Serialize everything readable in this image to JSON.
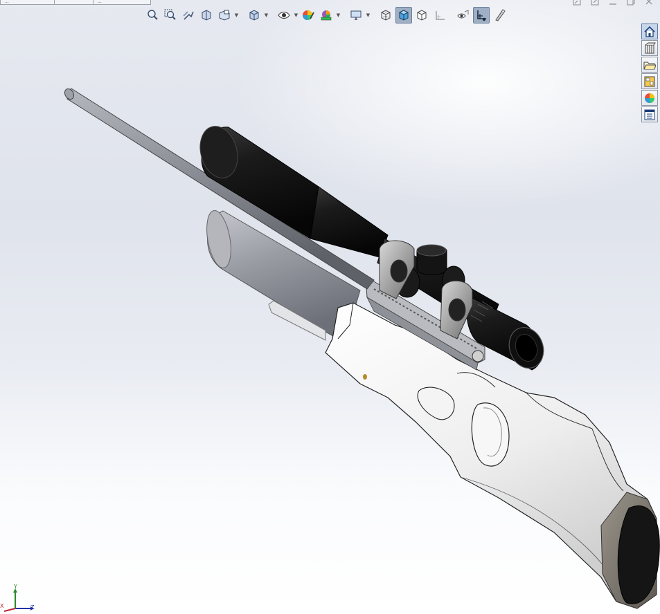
{
  "top_tabs": [
    {
      "label": "..."
    },
    {
      "label": ""
    },
    {
      "label": "..."
    }
  ],
  "toolbar": {
    "buttons": [
      {
        "icon": "zoom-to-fit-icon"
      },
      {
        "icon": "zoom-to-area-icon"
      },
      {
        "icon": "previous-view-icon"
      },
      {
        "icon": "section-view-icon"
      },
      {
        "icon": "dynamic-annotation-view-icon",
        "dropdown": true
      },
      {
        "icon": "view-orientation-icon",
        "dropdown": true
      },
      {
        "icon": "hide-show-items-icon",
        "dropdown": true
      },
      {
        "icon": "edit-appearance-icon"
      },
      {
        "icon": "apply-scene-icon",
        "dropdown": true
      },
      {
        "icon": "view-settings-icon",
        "dropdown": true
      },
      {
        "icon": "wireframe-icon"
      },
      {
        "icon": "shaded-with-edges-icon",
        "active": true
      },
      {
        "icon": "hidden-lines-visible-icon"
      },
      {
        "icon": "perspective-icon"
      },
      {
        "icon": "display-pane-icon"
      },
      {
        "icon": "view-planes-icon",
        "active": true
      },
      {
        "icon": "realview-icon"
      }
    ]
  },
  "window_controls": [
    "restore-tile-icon",
    "new-window-icon",
    "minimize-icon",
    "maximize-icon",
    "close-icon"
  ],
  "task_pane": [
    {
      "icon": "home-icon",
      "active": true
    },
    {
      "icon": "design-library-icon"
    },
    {
      "icon": "file-explorer-icon"
    },
    {
      "icon": "view-palette-icon"
    },
    {
      "icon": "appearances-scenes-icon"
    },
    {
      "icon": "custom-properties-icon"
    }
  ],
  "triad": {
    "x": "X",
    "y": "Y",
    "z": "Z"
  },
  "colors": {
    "accent_active": "#9fb0c6",
    "scope_body": "#1a1a1a",
    "barrel": "#8c8f97",
    "stock": "#f2f2f2",
    "air_tank": "#9ea1a9",
    "triad_x": "#c0272d",
    "triad_y": "#2a8a2a",
    "triad_z": "#2233aa"
  }
}
